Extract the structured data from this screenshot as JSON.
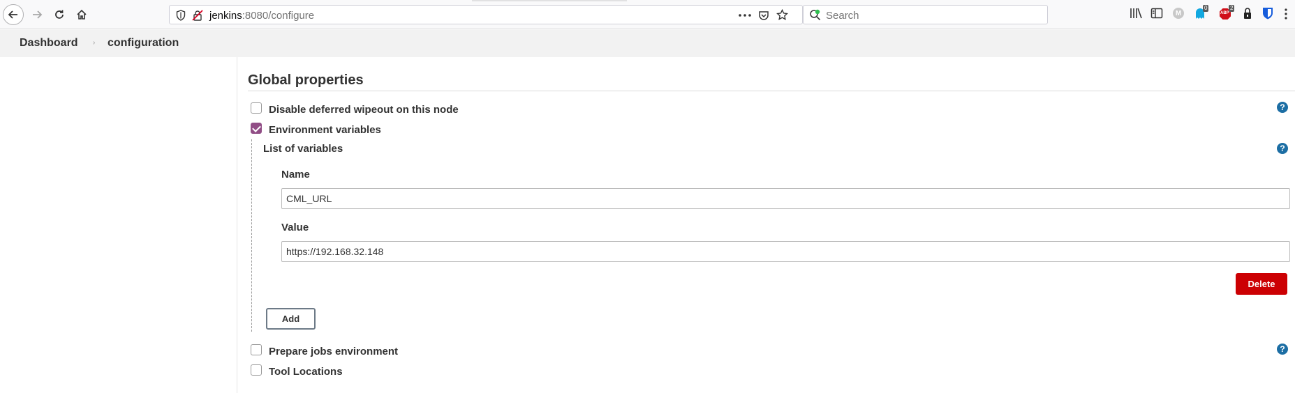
{
  "browser": {
    "url_host": "jenkins",
    "url_rest": ":8080/configure",
    "search_placeholder": "Search",
    "badge_notifications": "0",
    "badge_abp": "2",
    "abp_label": "ABP",
    "avatar_letter": "M"
  },
  "breadcrumb": {
    "items": [
      {
        "label": "Dashboard"
      },
      {
        "label": "configuration"
      }
    ],
    "separator": "›"
  },
  "section": {
    "title": "Global properties"
  },
  "options": {
    "disable_wipeout": {
      "label": "Disable deferred wipeout on this node",
      "checked": false
    },
    "env_vars": {
      "label": "Environment variables",
      "checked": true
    },
    "prepare_jobs": {
      "label": "Prepare jobs environment",
      "checked": false
    },
    "tool_locations": {
      "label": "Tool Locations",
      "checked": false
    }
  },
  "env_vars_list": {
    "title": "List of variables",
    "name_label": "Name",
    "name_value": "CML_URL",
    "value_label": "Value",
    "value_value": "https://192.168.32.148",
    "delete_label": "Delete",
    "add_label": "Add"
  },
  "help_glyph": "?",
  "colors": {
    "checkbox_checked": "#914e86",
    "delete_button": "#cc0003",
    "help_icon": "#1c6ea4"
  }
}
